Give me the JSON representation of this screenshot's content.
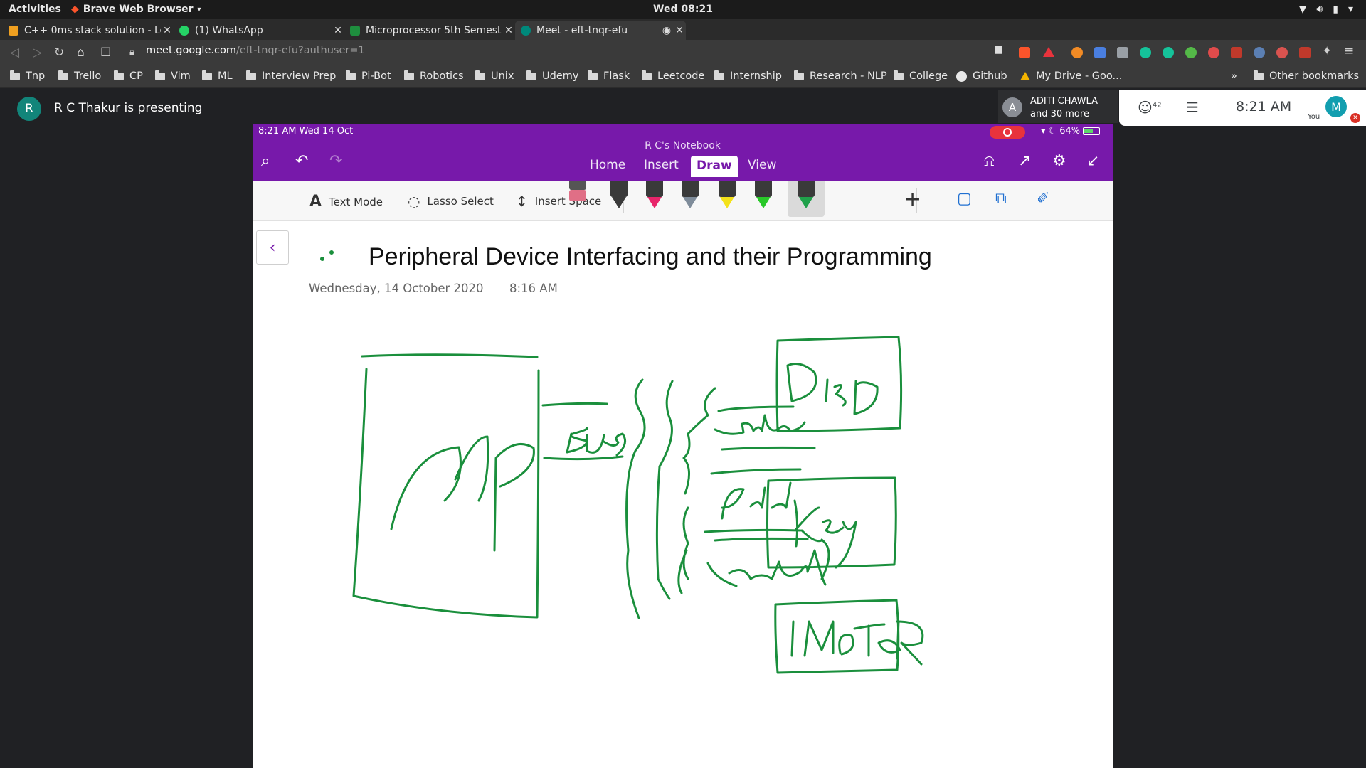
{
  "os_bar": {
    "activities": "Activities",
    "app_name": "Brave Web Browser",
    "clock": "Wed 08:21"
  },
  "tabs": [
    {
      "title": "C++ 0ms stack solution - Le",
      "fav_color": "#f0a020"
    },
    {
      "title": "(1) WhatsApp",
      "fav_color": "#25d366"
    },
    {
      "title": "Microprocessor 5th Semest",
      "fav_color": "#1e8e3e"
    },
    {
      "title": "Meet - eft-tnqr-efu",
      "fav_color": "#00897b"
    }
  ],
  "address": {
    "host": "meet.google.com",
    "path": "/eft-tnqr-efu?authuser=1"
  },
  "bookmarks": [
    "Tnp",
    "Trello",
    "CP",
    "Vim",
    "ML",
    "Interview Prep",
    "Pi-Bot",
    "Robotics",
    "Unix",
    "Udemy",
    "Flask",
    "Leetcode",
    "Internship",
    "Research - NLP",
    "College",
    "Github",
    "My Drive - Goo...",
    "»",
    "Other bookmarks"
  ],
  "meet": {
    "presenter_initial": "R",
    "presenting_text": "R C Thakur is presenting",
    "participant_initial": "A",
    "participant_name": "ADITI CHAWLA",
    "participant_more": "and 30 more",
    "people_count": "42",
    "time": "8:21 AM",
    "me_initial": "M",
    "me_label": "You"
  },
  "ipad": {
    "status_time": "8:21 AM   Wed 14 Oct",
    "battery": "64%",
    "notebook_name": "R C's Notebook",
    "ribbon_tabs": [
      "Home",
      "Insert",
      "Draw",
      "View"
    ],
    "tools": {
      "text_mode": "Text Mode",
      "lasso": "Lasso Select",
      "insert_space": "Insert Space"
    },
    "pen_colors": [
      "#e06f86",
      "#3a3a3a",
      "#e8256a",
      "#7f8c9a",
      "#f4e21a",
      "#28c828",
      "#1fa04a"
    ],
    "page_title": "Peripheral Device Interfacing and their Programming",
    "page_date": "Wednesday, 14 October 2020",
    "page_time": "8:16 AM",
    "ink_color": "#1a8f3c"
  }
}
